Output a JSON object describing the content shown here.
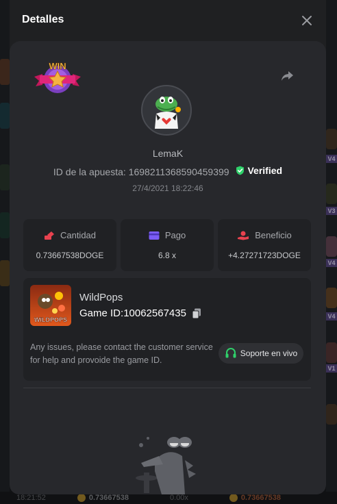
{
  "modal": {
    "title": "Detalles"
  },
  "bet": {
    "username": "LemaK",
    "bet_id_label": "ID de la apuesta:",
    "bet_id": "1698211368590459399",
    "verified_label": "Verified",
    "timestamp": "27/4/2021 18:22:46",
    "badge_text": "WIN"
  },
  "stats": [
    {
      "label": "Cantidad",
      "value": "0.73667538DOGE",
      "icon": "coins-icon"
    },
    {
      "label": "Pago",
      "value": "6.8 x",
      "icon": "wallet-icon"
    },
    {
      "label": "Beneficio",
      "value": "+4.27271723DOGE",
      "icon": "hand-coin-icon"
    }
  ],
  "game": {
    "name": "WildPops",
    "game_id_label": "Game ID:",
    "game_id": "10062567435",
    "thumb_text": "WILDPOPS",
    "help_text": "Any issues, please contact the customer service for help and provoide the game ID.",
    "support_label": "Soporte en vivo"
  },
  "background": {
    "right_tags": [
      "V4",
      "V3",
      "V4",
      "V4",
      "V1"
    ],
    "bottom_time": "18:21:52",
    "bottom_amount": "0.73667538",
    "bottom_mult": "0.00x",
    "bottom_amount2": "0.73667538"
  },
  "colors": {
    "accent_red": "#e8424f",
    "accent_purple": "#7a5cf5",
    "verified_green": "#2fd06a"
  }
}
